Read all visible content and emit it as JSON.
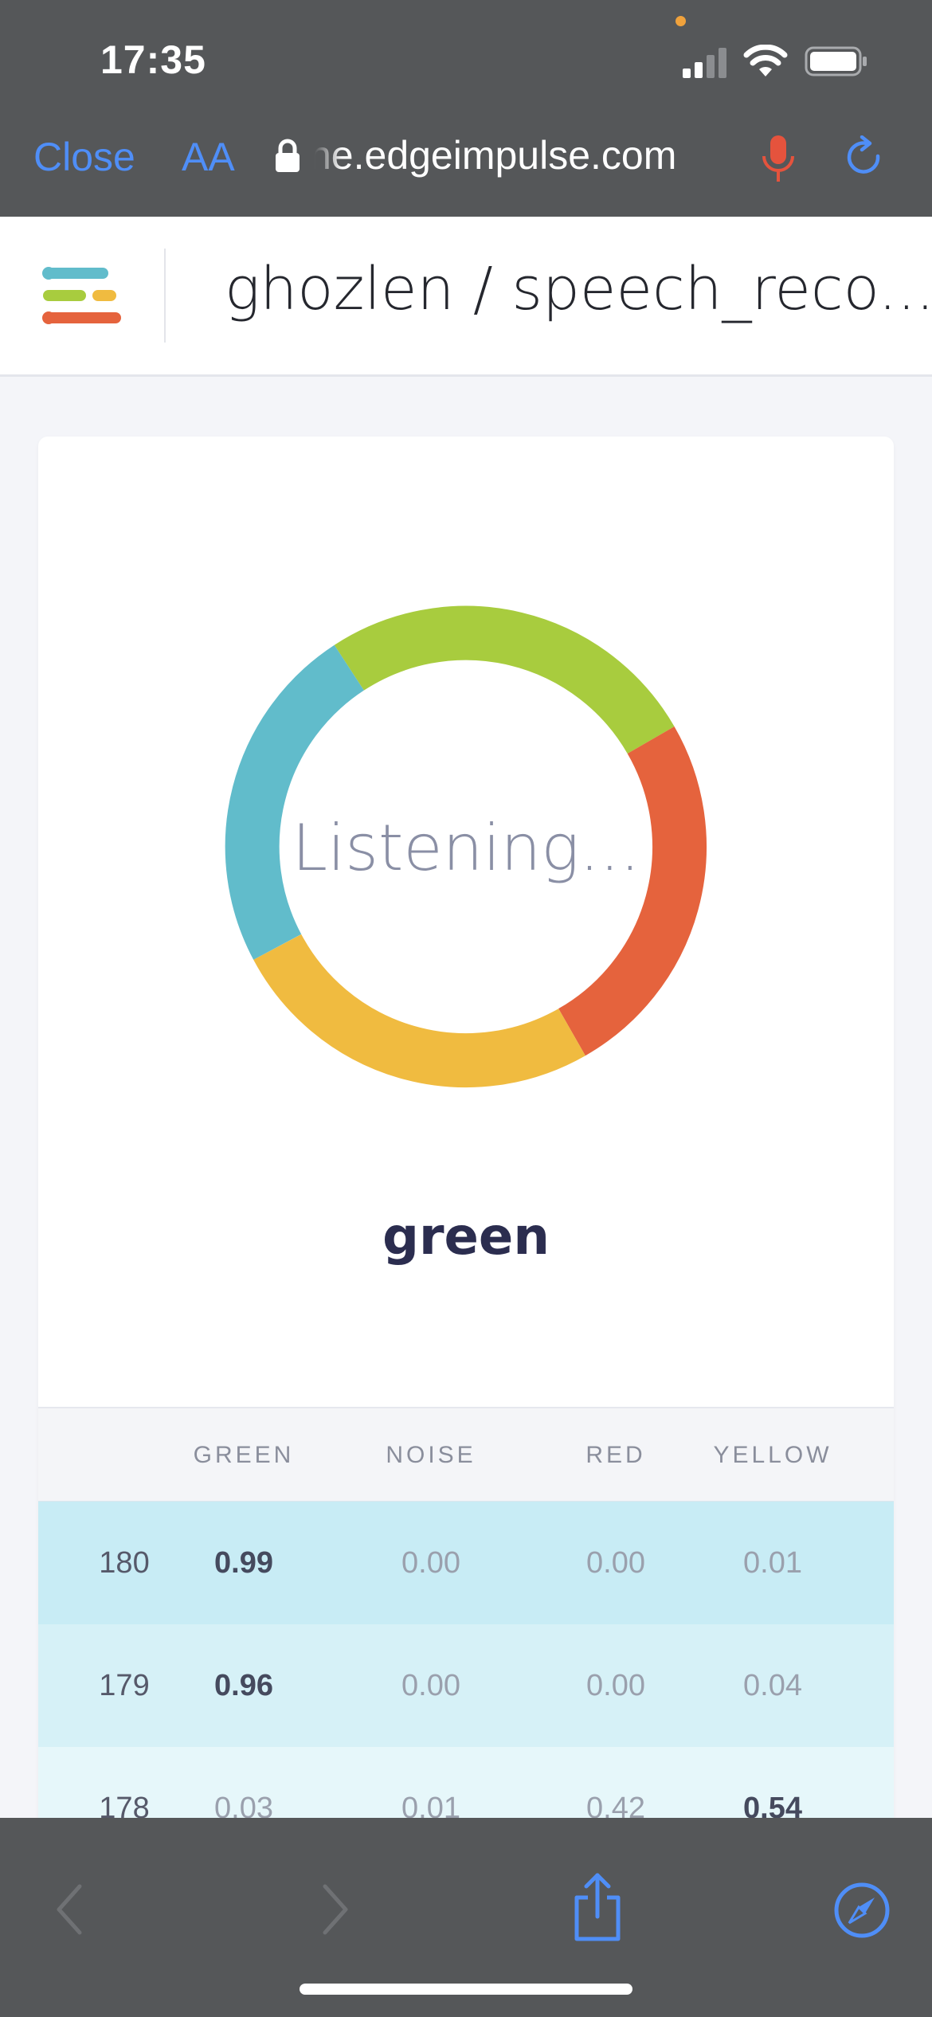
{
  "status_bar": {
    "time": "17:35",
    "icons": [
      "signal-icon",
      "wifi-icon",
      "battery-icon"
    ]
  },
  "browser": {
    "close_label": "Close",
    "text_size_label": "AA",
    "url": "ne.edgeimpulse.com",
    "icons": [
      "lock-icon",
      "microphone-icon",
      "reload-icon"
    ]
  },
  "header": {
    "title": "ghozlen / speech_reco..."
  },
  "classifier": {
    "status_text": "Listening...",
    "result": "green",
    "ring_colors": {
      "green": "#a8cc3e",
      "red": "#e5633d",
      "yellow": "#f0bb40",
      "blue": "#61bccb"
    }
  },
  "table": {
    "columns": [
      "",
      "GREEN",
      "NOISE",
      "RED",
      "YELLOW"
    ],
    "rows": [
      {
        "idx": "180",
        "green": "0.99",
        "noise": "0.00",
        "red": "0.00",
        "yellow": "0.01"
      },
      {
        "idx": "179",
        "green": "0.96",
        "noise": "0.00",
        "red": "0.00",
        "yellow": "0.04"
      },
      {
        "idx": "178",
        "green": "0.03",
        "noise": "0.01",
        "red": "0.42",
        "yellow": "0.54"
      }
    ]
  },
  "toolbar": {
    "icons": [
      "back-icon",
      "forward-icon",
      "share-icon",
      "compass-icon"
    ]
  },
  "colors": {
    "accent": "#4f8ef7",
    "chrome": "#555759",
    "mic": "#e5533d"
  }
}
